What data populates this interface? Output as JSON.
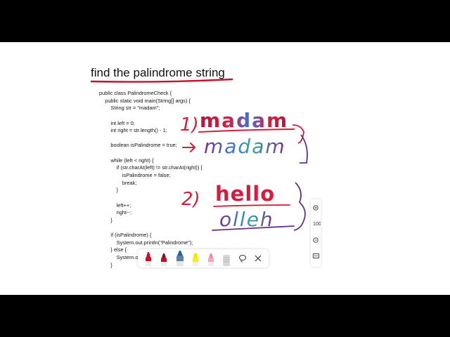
{
  "title": "find the palindrome string",
  "code_lines": [
    "public class PalindromeCheck {",
    "    public static void main(String[] args) {",
    "        String str = \"madam\";",
    "",
    "        int left = 0;",
    "        int right = str.length() - 1;",
    "",
    "        boolean isPalindrome = true;",
    "",
    "        while (left < right) {",
    "            if (str.charAt(left) != str.charAt(right)) {",
    "                isPalindrome = false;",
    "                break;",
    "            }",
    "",
    "            left++;",
    "            right--;",
    "        }",
    "",
    "        if (isPalindrome) {",
    "            System.out.println(\"Palindrome\");",
    "        } else {",
    "            System.out"
  ],
  "last_code_line": "        }",
  "annotations": {
    "item1_number": "1)",
    "item1_word": "madam",
    "item1_reversed": "madam",
    "item2_number": "2)",
    "item2_word": "hello",
    "item2_reversed": "olleh"
  },
  "zoom": {
    "level": "100"
  },
  "colors": {
    "red_ink": "#d81b3c",
    "purple_ink": "#6a2c8c",
    "title_underline": "#c8102e"
  },
  "toolbar": {
    "tools": [
      "red-marker",
      "dark-red-marker",
      "blue-pen",
      "yellow-highlighter",
      "pink-pen",
      "eraser",
      "lasso-icon",
      "close-icon"
    ]
  }
}
